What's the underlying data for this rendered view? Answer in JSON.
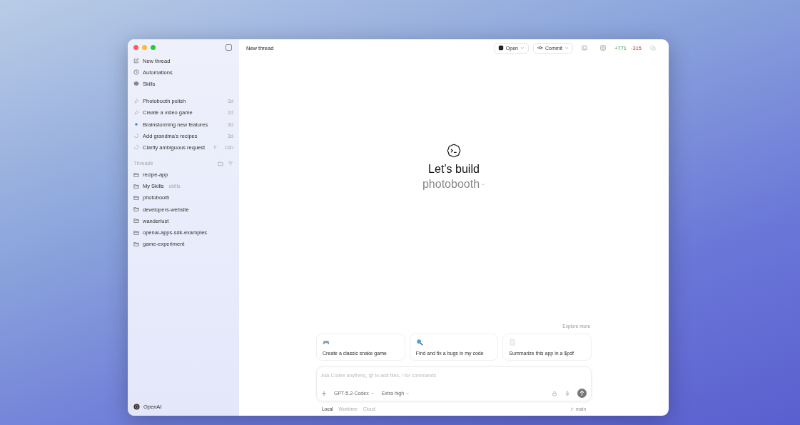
{
  "sidebar": {
    "nav": [
      {
        "label": "New thread"
      },
      {
        "label": "Automations"
      },
      {
        "label": "Skills"
      }
    ],
    "tasks": [
      {
        "title": "Photobooth polish",
        "time": "3d",
        "kind": "pinned"
      },
      {
        "title": "Create a video game",
        "time": "2d",
        "kind": "pinned"
      },
      {
        "title": "Brainstorming new features",
        "time": "3d",
        "kind": "unread"
      },
      {
        "title": "Add grandma's recipes",
        "time": "3d",
        "kind": "running"
      },
      {
        "title": "Clarify ambiguous request",
        "time": "16h",
        "kind": "running",
        "branch": true
      }
    ],
    "threads_heading": "Threads",
    "threads": [
      {
        "name": "recipe-app"
      },
      {
        "name": "My Skills",
        "tag": "skills"
      },
      {
        "name": "photobooth"
      },
      {
        "name": "developers-website"
      },
      {
        "name": "wanderlust"
      },
      {
        "name": "openai-apps-sdk-examples"
      },
      {
        "name": "game-experiment"
      }
    ],
    "account": "OpenAI"
  },
  "header": {
    "title": "New thread",
    "open": "Open",
    "commit": "Commit",
    "added": "+771",
    "removed": "-315"
  },
  "hero": {
    "title": "Let’s build",
    "project": "photobooth"
  },
  "explore": "Explore more",
  "suggestions": [
    {
      "text": "Create a classic snake game"
    },
    {
      "text": "Find and fix a bugs in my code"
    },
    {
      "text": "Summarize this app in a $pdf"
    }
  ],
  "composer": {
    "placeholder": "Ask Codex anything, @ to add files, / for commands",
    "model": "GPT-5.2-Codex",
    "effort": "Extra high"
  },
  "modes": [
    {
      "label": "Local",
      "selected": true
    },
    {
      "label": "Worktree",
      "selected": false
    },
    {
      "label": "Cloud",
      "selected": false
    }
  ],
  "branch": "main"
}
